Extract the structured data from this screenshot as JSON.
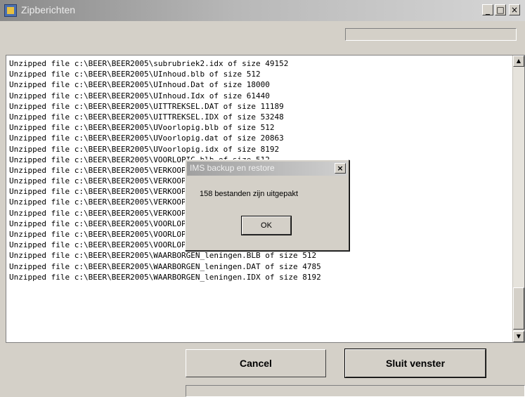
{
  "window": {
    "title": "Zipberichten",
    "minimize_glyph": "_",
    "maximize_glyph": "□",
    "close_glyph": "×",
    "icon": "zip-app-icon"
  },
  "progress": {
    "fraction": 0.0
  },
  "log": {
    "lines": [
      "Unzipped file c:\\BEER\\BEER2005\\subrubriek2.idx of size 49152",
      "Unzipped file c:\\BEER\\BEER2005\\UInhoud.blb of size 512",
      "Unzipped file c:\\BEER\\BEER2005\\UInhoud.Dat of size 18000",
      "Unzipped file c:\\BEER\\BEER2005\\UInhoud.Idx of size 61440",
      "Unzipped file c:\\BEER\\BEER2005\\UITTREKSEL.DAT of size 11189",
      "Unzipped file c:\\BEER\\BEER2005\\UITTREKSEL.IDX of size 53248",
      "Unzipped file c:\\BEER\\BEER2005\\UVoorlopig.blb of size 512",
      "Unzipped file c:\\BEER\\BEER2005\\UVoorlopig.dat of size 20863",
      "Unzipped file c:\\BEER\\BEER2005\\UVoorlopig.idx of size 8192",
      "Unzipped file c:\\BEER\\BEER2005\\VOORLOPIG.blb of size 512",
      "Unzipped file c:\\BEER\\BEER2005\\VERKOOP.BLB of size 512",
      "Unzipped file c:\\BEER\\BEER2005\\VERKOOP.DAT of size 24703",
      "Unzipped file c:\\BEER\\BEER2005\\VERKOOP.IDX of size 24703",
      "Unzipped file c:\\BEER\\BEER2005\\VERKOOP2.IDX of size 8192",
      "Unzipped file c:\\BEER\\BEER2005\\VERKOOP3.IDX of size 8192",
      "Unzipped file c:\\BEER\\BEER2005\\VOORLOPIG.BLB of size 512",
      "Unzipped file c:\\BEER\\BEER2005\\VOORLOPIG.DAT of size 21631",
      "Unzipped file c:\\BEER\\BEER2005\\VOORLOPIG.IDX of size 8192",
      "Unzipped file c:\\BEER\\BEER2005\\WAARBORGEN_leningen.BLB of size 512",
      "Unzipped file c:\\BEER\\BEER2005\\WAARBORGEN_leningen.DAT of size 4785",
      "Unzipped file c:\\BEER\\BEER2005\\WAARBORGEN_leningen.IDX of size 8192"
    ]
  },
  "buttons": {
    "cancel_label": "Cancel",
    "close_label": "Sluit venster"
  },
  "dialog": {
    "title": "IMS backup en restore",
    "message": "158 bestanden zijn uitgepakt",
    "ok_label": "OK",
    "close_glyph": "×"
  },
  "scrollbar": {
    "up_glyph": "▲",
    "down_glyph": "▼"
  }
}
